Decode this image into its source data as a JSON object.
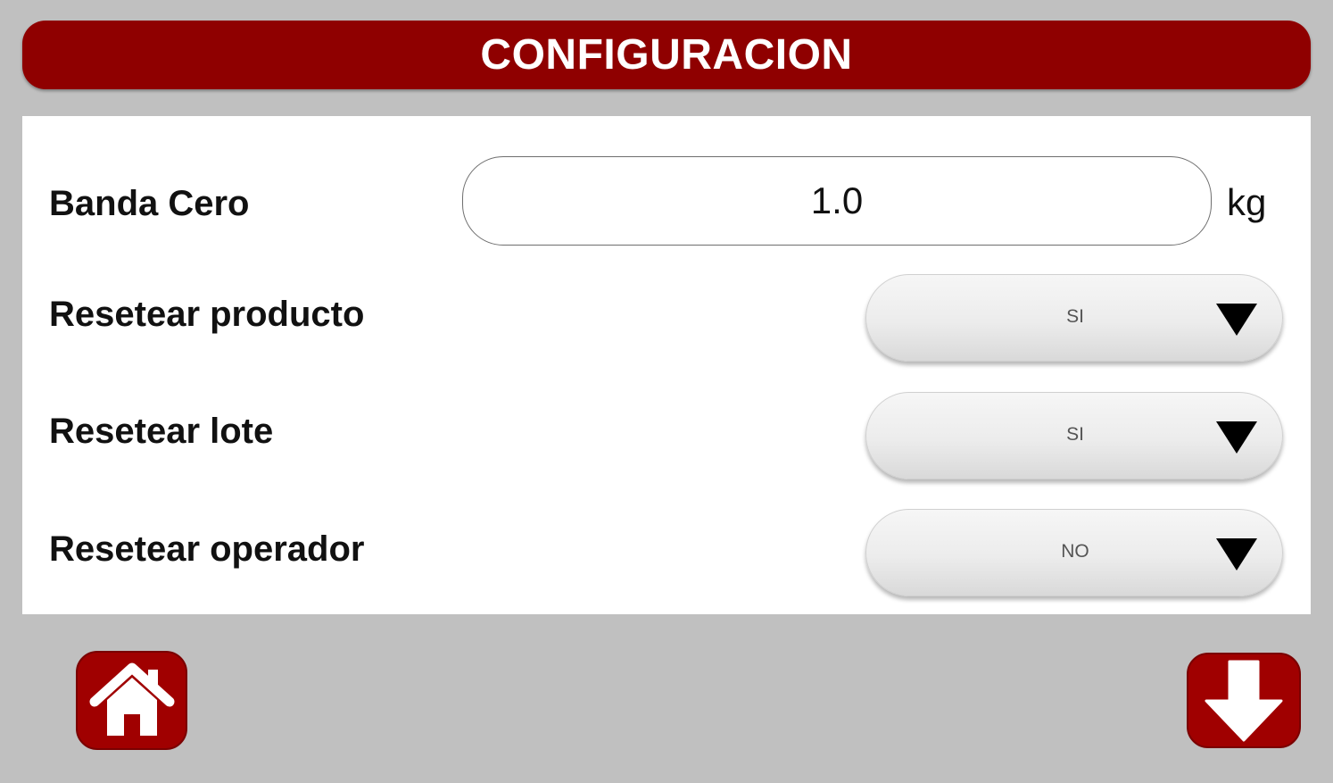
{
  "header": {
    "title": "CONFIGURACION"
  },
  "settings": {
    "banda_cero": {
      "label": "Banda Cero",
      "value": "1.0",
      "unit": "kg"
    },
    "rows": [
      {
        "label": "Resetear producto",
        "selected": "SI"
      },
      {
        "label": "Resetear lote",
        "selected": "SI"
      },
      {
        "label": "Resetear operador",
        "selected": "NO"
      }
    ]
  },
  "footer": {
    "home_icon": "home-icon",
    "next_icon": "arrow-down-icon"
  },
  "colors": {
    "brand_red": "#8f0000",
    "background": "#c0c0c0",
    "panel": "#ffffff"
  }
}
